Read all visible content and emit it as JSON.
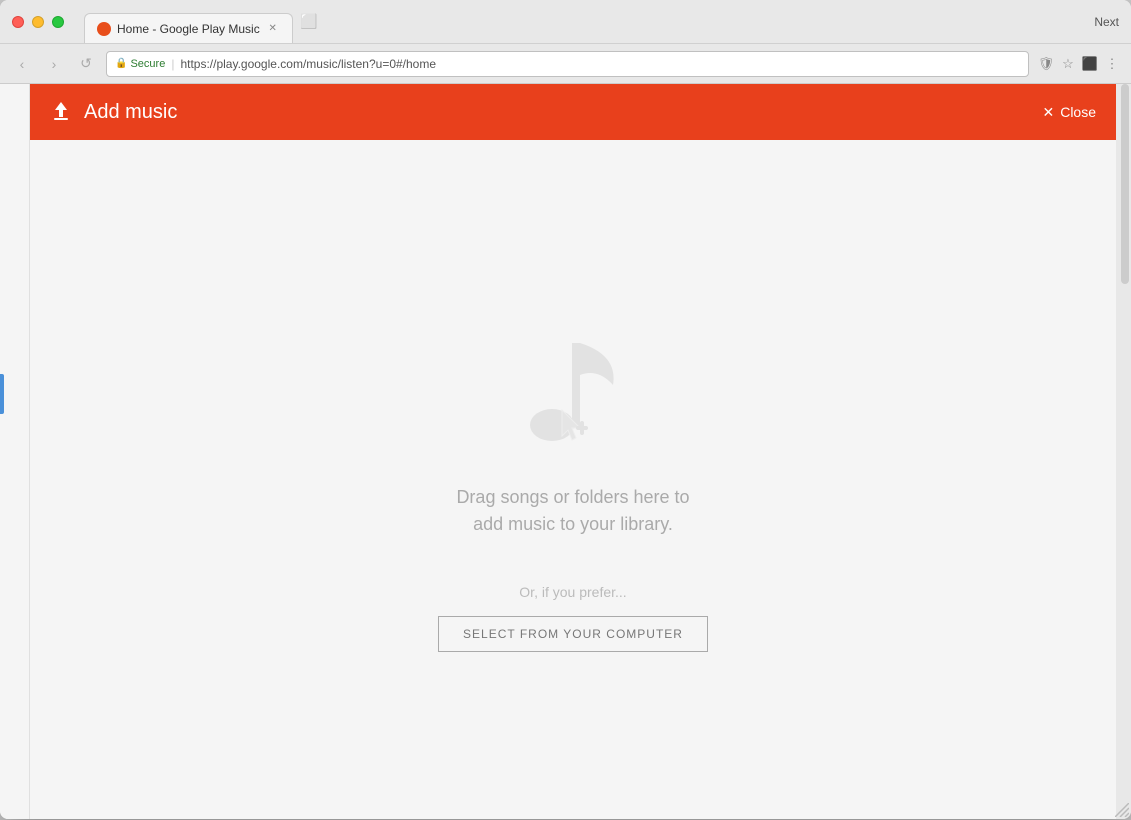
{
  "window": {
    "title": "Home - Google Play Music",
    "next_label": "Next"
  },
  "browser": {
    "tab_title": "Home - Google Play Music",
    "url": "https://play.google.com/music/listen?u=0#/home",
    "secure_label": "Secure",
    "nav_back": "‹",
    "nav_forward": "›",
    "nav_refresh": "↺"
  },
  "header": {
    "upload_icon": "⬆",
    "title": "Add music",
    "close_icon": "✕",
    "close_label": "Close"
  },
  "dropzone": {
    "drag_text_line1": "Drag songs or folders here to",
    "drag_text_line2": "add music to your library.",
    "or_prefer_label": "Or, if you prefer...",
    "select_btn_label": "SELECT FROM YOUR COMPUTER"
  },
  "colors": {
    "header_bg": "#e8401c",
    "accent": "#4a90d9"
  }
}
